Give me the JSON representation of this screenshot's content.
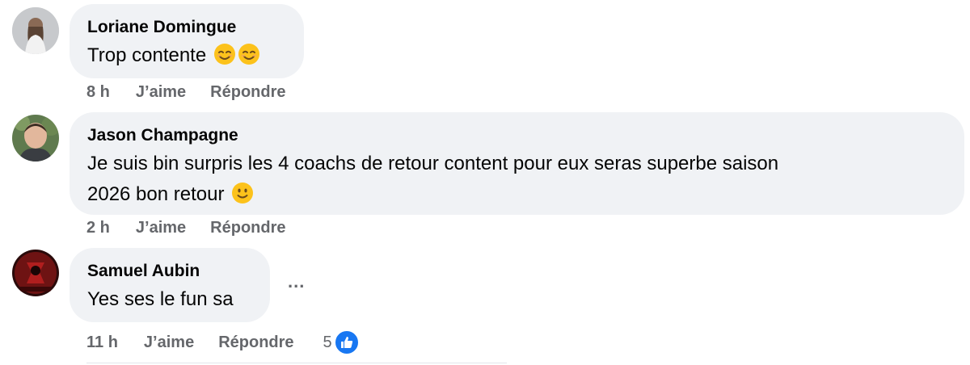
{
  "comments": [
    {
      "author": "Loriane Domingue",
      "text": "Trop contente",
      "emojis": [
        "smiling-face-with-smiling-eyes",
        "smiling-face-with-smiling-eyes"
      ],
      "time": "8 h",
      "like_label": "J’aime",
      "reply_label": "Répondre"
    },
    {
      "author": "Jason Champagne",
      "text_line1": "Je suis bin surpris les 4 coachs de retour content pour eux seras superbe saison",
      "text_line2": "2026 bon retour",
      "emojis": [
        "slightly-smiling-face"
      ],
      "time": "2 h",
      "like_label": "J’aime",
      "reply_label": "Répondre"
    },
    {
      "author": "Samuel Aubin",
      "text": "Yes ses le fun sa",
      "time": "11 h",
      "like_label": "J’aime",
      "reply_label": "Répondre",
      "reaction_count": "5",
      "more_label": "..."
    }
  ],
  "colors": {
    "bubble_bg": "#f0f2f5",
    "meta_text": "#65676b",
    "like_blue": "#1877f2"
  }
}
